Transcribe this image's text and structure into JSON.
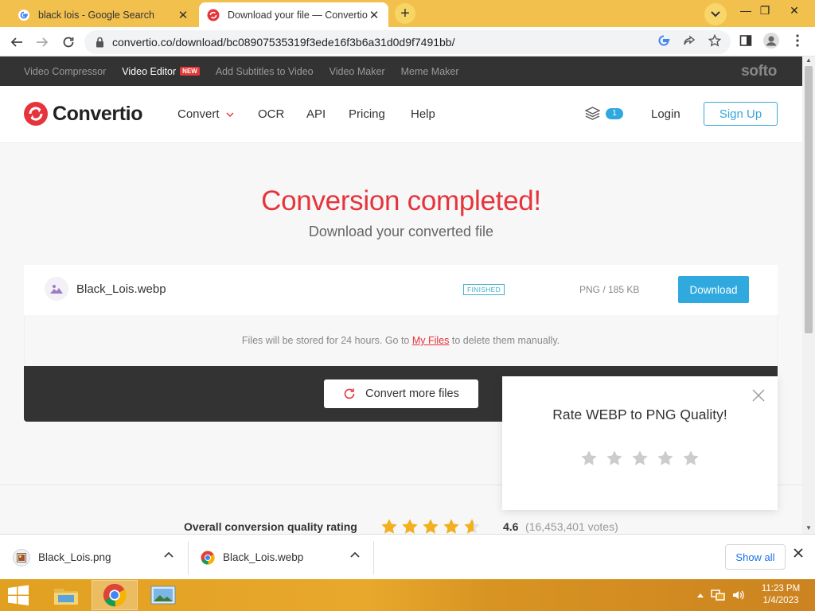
{
  "browser": {
    "tabs": [
      {
        "title": "black lois - Google Search"
      },
      {
        "title": "Download your file — Convertio"
      }
    ],
    "url": "convertio.co/download/bc08907535319f3ede16f3b6a31d0d9f7491bb/"
  },
  "topbar": {
    "links": [
      "Video Compressor",
      "Video Editor",
      "Add Subtitles to Video",
      "Video Maker",
      "Meme Maker"
    ],
    "new_badge": "NEW",
    "brand": "softo"
  },
  "nav": {
    "logo_text": "Convertio",
    "items": [
      "Convert",
      "OCR",
      "API",
      "Pricing",
      "Help"
    ],
    "files_count": "1",
    "login": "Login",
    "signup": "Sign Up"
  },
  "main": {
    "headline": "Conversion completed!",
    "subheadline": "Download your converted file",
    "file": {
      "name": "Black_Lois.webp",
      "status": "FINISHED",
      "info": "PNG / 185 KB",
      "download_label": "Download"
    },
    "storage_note_before": "Files will be stored for 24 hours. Go to ",
    "storage_link": "My Files",
    "storage_note_after": " to delete them manually.",
    "convert_more": "Convert more files"
  },
  "rating_popup": {
    "title": "Rate WEBP to PNG Quality!",
    "stars": 0,
    "max_stars": 5
  },
  "overall_rating": {
    "label": "Overall conversion quality rating",
    "score": "4.6",
    "votes": "(16,453,401 votes)",
    "stars_value": 4.6
  },
  "downloads": {
    "items": [
      {
        "name": "Black_Lois.png"
      },
      {
        "name": "Black_Lois.webp"
      }
    ],
    "show_all": "Show all"
  },
  "taskbar": {
    "time": "11:23 PM",
    "date": "1/4/2023"
  },
  "colors": {
    "accent_red": "#e6343c",
    "accent_blue": "#30a9de",
    "tabstrip": "#f2c04d",
    "star_gold": "#f2b01e",
    "star_empty": "#cccccc"
  }
}
